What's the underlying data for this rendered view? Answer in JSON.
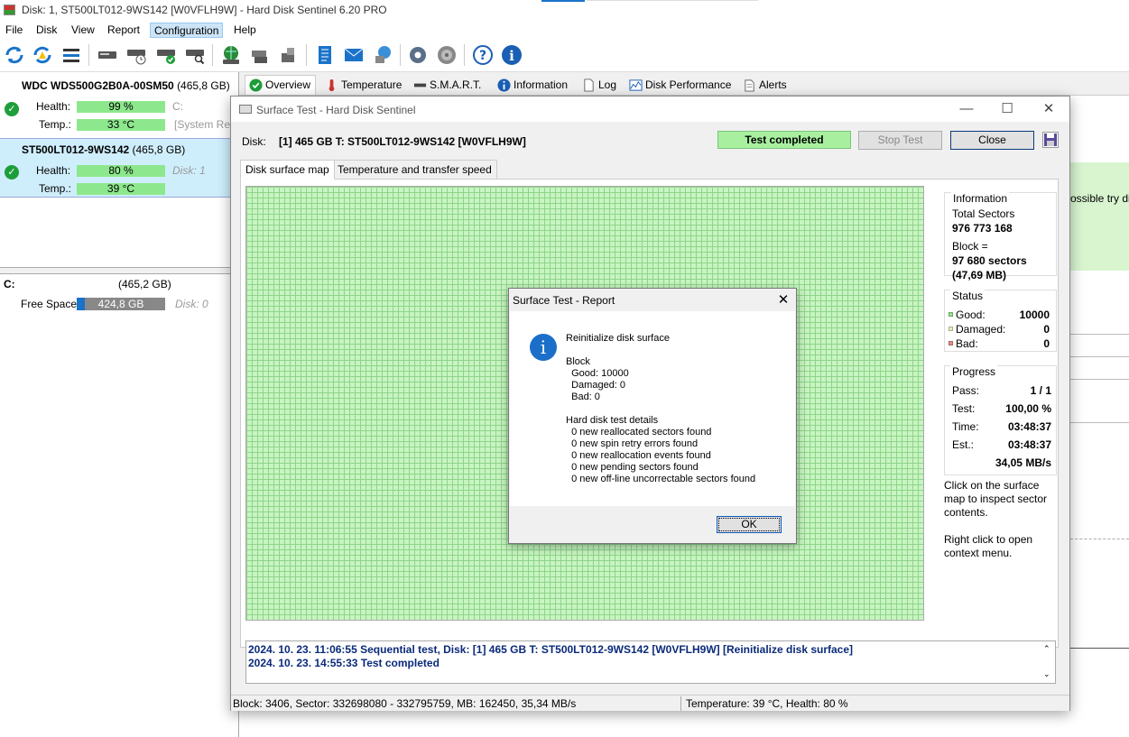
{
  "window": {
    "title": "Disk: 1, ST500LT012-9WS142 [W0VFLH9W]  -  Hard Disk Sentinel 6.20 PRO"
  },
  "menu": [
    "File",
    "Disk",
    "View",
    "Report",
    "Configuration",
    "Help"
  ],
  "toolbar_icons": [
    "refresh-icon",
    "refresh-all-icon",
    "disk-list-icon",
    "disk-icon",
    "disk-schedule-icon",
    "disk-check-icon",
    "disk-search-icon",
    "globe-icon",
    "network-disk-icon",
    "usb-disk-icon",
    "report-icon",
    "mail-icon",
    "upload-icon",
    "settings-icon",
    "sound-icon",
    "help-icon",
    "info-icon"
  ],
  "disks": [
    {
      "model": "WDC  WDS500G2B0A-00SM50",
      "size": "(465,8 GB)",
      "health_label": "Health:",
      "health": "99 %",
      "temp_label": "Temp.:",
      "temp": "33 °C",
      "drive": "C:",
      "note": "[System Re"
    },
    {
      "model": "ST500LT012-9WS142",
      "size": "(465,8 GB)",
      "health_label": "Health:",
      "health": "80 %",
      "temp_label": "Temp.:",
      "temp": "39 °C",
      "disk_ref": "Disk: 1"
    }
  ],
  "partition": {
    "letter": "C:",
    "size": "(465,2 GB)",
    "free_label": "Free Space",
    "free": "424,8 GB",
    "disk_ref": "Disk: 0",
    "free_fraction": 0.91
  },
  "main_tabs": [
    "Overview",
    "Temperature",
    "S.M.A.R.T.",
    "Information",
    "Log",
    "Disk Performance",
    "Alerts"
  ],
  "background_text": "ossible try di",
  "surface": {
    "title": "Surface Test - Hard Disk Sentinel",
    "disk_label": "Disk:",
    "disk_value": "[1] 465 GB T: ST500LT012-9WS142 [W0VFLH9W]",
    "status": "Test completed",
    "stop_label": "Stop Test",
    "close_label": "Close",
    "tabs": [
      "Disk surface map",
      "Temperature and transfer speed"
    ],
    "info": {
      "title": "Information",
      "total_label": "Total Sectors",
      "total": "976 773 168",
      "block_label": "Block =",
      "block_sectors": "97 680 sectors",
      "block_mb": "(47,69 MB)"
    },
    "status_box": {
      "title": "Status",
      "good_label": "Good:",
      "good": "10000",
      "damaged_label": "Damaged:",
      "damaged": "0",
      "bad_label": "Bad:",
      "bad": "0"
    },
    "progress": {
      "title": "Progress",
      "pass_label": "Pass:",
      "pass": "1 / 1",
      "test_label": "Test:",
      "test": "100,00 %",
      "time_label": "Time:",
      "time": "03:48:37",
      "est_label": "Est.:",
      "est": "03:48:37",
      "speed": "34,05 MB/s"
    },
    "hint1": [
      "Click on the surface",
      "map to inspect sector",
      "contents."
    ],
    "hint2": [
      "Right click to open",
      "context menu."
    ],
    "log": [
      "2024. 10. 23.  11:06:55   Sequential test, Disk: [1] 465 GB T: ST500LT012-9WS142 [W0VFLH9W] [Reinitialize disk surface]",
      "2024. 10. 23.  14:55:33   Test completed"
    ],
    "statusbar_left": "Block: 3406, Sector: 332698080 - 332795759, MB: 162450, 35,34 MB/s",
    "statusbar_right": "Temperature: 39  °C,  Health: 80 %"
  },
  "report": {
    "title": "Surface Test - Report",
    "lines": [
      "Reinitialize disk surface",
      "",
      "Block",
      "  Good: 10000",
      "  Damaged: 0",
      "  Bad: 0",
      "",
      "Hard disk test details",
      "  0 new reallocated sectors found",
      "  0 new spin retry errors found",
      "  0 new reallocation events found",
      "  0 new pending sectors found",
      "  0 new off-line uncorrectable sectors found"
    ],
    "ok_label": "OK"
  }
}
